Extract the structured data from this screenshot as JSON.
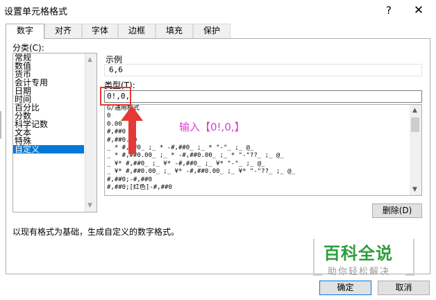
{
  "dialog": {
    "title": "设置单元格格式",
    "help": "?",
    "close": "✕"
  },
  "tabs": [
    {
      "label": "数字",
      "active": true
    },
    {
      "label": "对齐",
      "active": false
    },
    {
      "label": "字体",
      "active": false
    },
    {
      "label": "边框",
      "active": false
    },
    {
      "label": "填充",
      "active": false
    },
    {
      "label": "保护",
      "active": false
    }
  ],
  "category": {
    "label": "分类(C):",
    "items": [
      "常规",
      "数值",
      "货币",
      "会计专用",
      "日期",
      "时间",
      "百分比",
      "分数",
      "科学记数",
      "文本",
      "特殊",
      "自定义"
    ],
    "selected": "自定义"
  },
  "sample": {
    "label": "示例",
    "value": "6,6"
  },
  "type": {
    "label": "类型(T):",
    "value": "0!,0,"
  },
  "formats": [
    "G/通用格式",
    "0",
    "0.00",
    "#,##0",
    "#,##0.00",
    "_ * #,##0_ ;_ * -#,##0_ ;_ * \"-\"_ ;_ @_",
    "_ * #,##0.00_ ;_ * -#,##0.00_ ;_ * \"-\"??_ ;_ @_",
    "_ ¥* #,##0_ ;_ ¥* -#,##0_ ;_ ¥* \"-\"_ ;_ @_",
    "_ ¥* #,##0.00_ ;_ ¥* -#,##0.00_ ;_ ¥* \"-\"??_ ;_ @_",
    "#,##0;-#,##0",
    "#,##0;[红色]-#,##0"
  ],
  "delete_button": "删除(D)",
  "description": "以现有格式为基础，生成自定义的数字格式。",
  "ok_button": "确定",
  "cancel_button": "取消",
  "annotation": {
    "text": "输入【0!,0,】",
    "color": "#d63fd6",
    "box_color": "#e53935"
  },
  "watermark": {
    "main": "百科全说",
    "sub": "助你轻松解决",
    "color": "#2e9d3b"
  }
}
